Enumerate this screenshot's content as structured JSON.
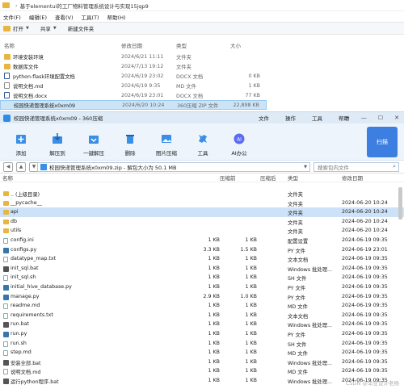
{
  "explorer": {
    "breadcrumb": [
      "基于elementui的工厂物料管理系统设计与实现15jqp9"
    ],
    "menu": [
      "文件(F)",
      "编辑(E)",
      "查看(V)",
      "工具(T)",
      "帮助(H)"
    ],
    "toolbar": {
      "open": "打开",
      "share": "共享",
      "new_folder": "新建文件夹"
    },
    "columns": {
      "name": "名称",
      "modified": "修改日期",
      "type": "类型",
      "size": "大小"
    },
    "rows": [
      {
        "icon": "folder-icon",
        "name": "环境安装环境",
        "modified": "2024/6/21 11:11",
        "type": "文件夹",
        "size": ""
      },
      {
        "icon": "folder-icon",
        "name": "数据库文件",
        "modified": "2024/7/13 19:12",
        "type": "文件夹",
        "size": ""
      },
      {
        "icon": "docx-icon",
        "name": "python-flask环境配置文档",
        "modified": "2024/6/19 23:02",
        "type": "DOCX 文档",
        "size": "0 KB"
      },
      {
        "icon": "md-icon",
        "name": "说明文档.md",
        "modified": "2024/6/19 9:35",
        "type": "MD 文件",
        "size": "1 KB"
      },
      {
        "icon": "docx-icon",
        "name": "说明文档.docx",
        "modified": "2024/6/19 23:01",
        "type": "DOCX 文档",
        "size": "77 KB"
      },
      {
        "icon": "zip-icon",
        "name": "校园快递管理系统x0xm09",
        "modified": "2024/6/20 10:24",
        "type": "360压缩 ZIP 文件",
        "size": "22,898 KB",
        "selected": true
      }
    ]
  },
  "zip": {
    "title": "校园快递管理系统x0xm09 - 360压缩",
    "menus": [
      "文件",
      "操作",
      "工具",
      "帮助"
    ],
    "window_buttons": [
      "≡",
      "—",
      "☐",
      "✕"
    ],
    "tools": [
      {
        "label": "添加",
        "icon": "add-icon"
      },
      {
        "label": "解压到",
        "icon": "extract-to-icon"
      },
      {
        "label": "一键解压",
        "icon": "one-click-extract-icon"
      },
      {
        "label": "删除",
        "icon": "delete-icon"
      },
      {
        "label": "图片压缩",
        "icon": "image-compress-icon"
      },
      {
        "label": "工具",
        "icon": "tools-icon"
      },
      {
        "label": "AI办公",
        "icon": "ai-office-icon"
      }
    ],
    "scan_label": "扫描",
    "address": "校园快递管理系统x0xm09.zip - 解包大小为 50.1 MB",
    "search_placeholder": "搜索包内文件",
    "columns": {
      "name": "名称",
      "before": "压缩前",
      "after": "压缩后",
      "type": "类型",
      "date": "修改日期"
    },
    "rows": [
      {
        "icon": "up",
        "name": ".. (上级目录)",
        "before": "",
        "after": "",
        "type": "文件夹",
        "date": ""
      },
      {
        "icon": "folder",
        "name": "__pycache__",
        "before": "",
        "after": "",
        "type": "文件夹",
        "date": "2024-06-20 10:24"
      },
      {
        "icon": "folder",
        "name": "api",
        "before": "",
        "after": "",
        "type": "文件夹",
        "date": "2024-06-20 10:24",
        "selected": true
      },
      {
        "icon": "folder",
        "name": "db",
        "before": "",
        "after": "",
        "type": "文件夹",
        "date": "2024-06-20 10:24"
      },
      {
        "icon": "folder",
        "name": "utils",
        "before": "",
        "after": "",
        "type": "文件夹",
        "date": "2024-06-20 10:24"
      },
      {
        "icon": "file",
        "name": "config.ini",
        "before": "1 KB",
        "after": "1 KB",
        "type": "配置设置",
        "date": "2024-06-19 09:35"
      },
      {
        "icon": "py",
        "name": "configs.py",
        "before": "3.3 KB",
        "after": "1.5 KB",
        "type": "PY 文件",
        "date": "2024-06-19 23:01"
      },
      {
        "icon": "file",
        "name": "datatype_map.txt",
        "before": "1 KB",
        "after": "1 KB",
        "type": "文本文档",
        "date": "2024-06-19 09:35"
      },
      {
        "icon": "bat",
        "name": "init_sql.bat",
        "before": "1 KB",
        "after": "1 KB",
        "type": "Windows 批处理...",
        "date": "2024-06-19 09:35"
      },
      {
        "icon": "file",
        "name": "init_sql.sh",
        "before": "1 KB",
        "after": "1 KB",
        "type": "SH 文件",
        "date": "2024-06-19 09:35"
      },
      {
        "icon": "py",
        "name": "initial_hive_database.py",
        "before": "1 KB",
        "after": "1 KB",
        "type": "PY 文件",
        "date": "2024-06-19 09:35"
      },
      {
        "icon": "py",
        "name": "manage.py",
        "before": "2.9 KB",
        "after": "1.0 KB",
        "type": "PY 文件",
        "date": "2024-06-19 09:35"
      },
      {
        "icon": "file",
        "name": "readme.md",
        "before": "1 KB",
        "after": "1 KB",
        "type": "MD 文件",
        "date": "2024-06-19 09:35"
      },
      {
        "icon": "file",
        "name": "requirements.txt",
        "before": "1 KB",
        "after": "1 KB",
        "type": "文本文档",
        "date": "2024-06-19 09:35"
      },
      {
        "icon": "bat",
        "name": "run.bat",
        "before": "1 KB",
        "after": "1 KB",
        "type": "Windows 批处理...",
        "date": "2024-06-19 09:35"
      },
      {
        "icon": "py",
        "name": "run.py",
        "before": "1 KB",
        "after": "1 KB",
        "type": "PY 文件",
        "date": "2024-06-19 09:35"
      },
      {
        "icon": "file",
        "name": "run.sh",
        "before": "1 KB",
        "after": "1 KB",
        "type": "SH 文件",
        "date": "2024-06-19 09:35"
      },
      {
        "icon": "file",
        "name": "step.md",
        "before": "1 KB",
        "after": "1 KB",
        "type": "MD 文件",
        "date": "2024-06-19 09:35"
      },
      {
        "icon": "bat",
        "name": "安装全部.bat",
        "before": "1 KB",
        "after": "1 KB",
        "type": "Windows 批处理...",
        "date": "2024-06-19 09:35"
      },
      {
        "icon": "file",
        "name": "说明文档.md",
        "before": "1 KB",
        "after": "1 KB",
        "type": "MD 文件",
        "date": "2024-06-19 09:35"
      },
      {
        "icon": "bat",
        "name": "运行python程序.bat",
        "before": "1 KB",
        "after": "1 KB",
        "type": "Windows 批处理...",
        "date": "2024-06-19 09:35"
      }
    ],
    "watermark": "CSDN @毕业设计老杨"
  }
}
